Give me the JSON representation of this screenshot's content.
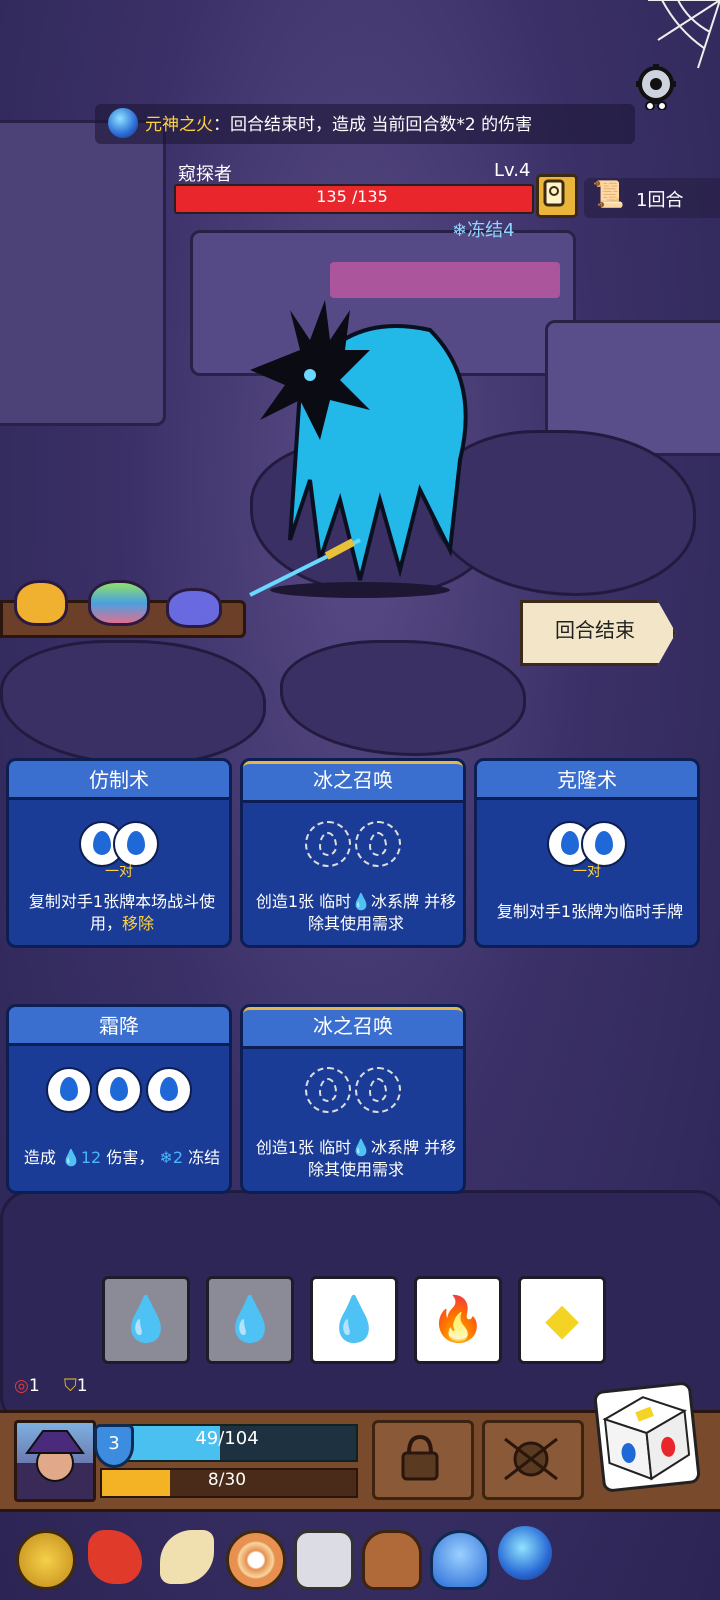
{
  "status_effect": {
    "name": "元神之火",
    "description": "：回合结束时，造成 当前回合数*2 的伤害",
    "icon": "blue-spirit-flame-icon"
  },
  "settings": {
    "icon": "gear-icon"
  },
  "enemy": {
    "name": "窥探者",
    "level": "Lv.4",
    "hp_text": "135 /135",
    "hp_fraction": 1.0,
    "freeze": "冻结4",
    "info_icon": "info-scroll-icon"
  },
  "turn": {
    "label": "1回合",
    "icon": "scroll-icon"
  },
  "end_turn_label": "回合结束",
  "potions": [
    {
      "name": "amber-potion-icon",
      "color": "#f0b030"
    },
    {
      "name": "rainbow-potion-icon",
      "color": "#8fe06a"
    },
    {
      "name": "blue-potion-icon",
      "color": "#6a6ae0"
    }
  ],
  "cards": [
    {
      "title": "仿制术",
      "pair": "一对",
      "desc_main": "复制对手1张牌本场战斗使用，",
      "desc_hl": "移除"
    },
    {
      "title": "冰之召唤",
      "desc_a": "创造1张 临时",
      "desc_b": "冰系牌 并移除其使用需求"
    },
    {
      "title": "克隆术",
      "pair": "一对",
      "desc_main": "复制对手1张牌为临时手牌"
    },
    {
      "title": "霜降",
      "desc_a": "造成",
      "desc_dmg": "12",
      "desc_b": "伤害，",
      "desc_freeze": "2",
      "desc_c": "冻结"
    },
    {
      "title": "冰之召唤",
      "desc_a": "创造1张 临时",
      "desc_b": "冰系牌 并移除其使用需求"
    }
  ],
  "dice": [
    {
      "type": "water",
      "used": true
    },
    {
      "type": "water",
      "used": true
    },
    {
      "type": "water",
      "used": false
    },
    {
      "type": "fire",
      "used": false
    },
    {
      "type": "gold",
      "used": false
    }
  ],
  "player": {
    "shield": "3",
    "hp_text": "49/104",
    "hp_fraction": 0.47,
    "xp_text": "8/30",
    "xp_fraction": 0.27,
    "attack_counter": "1",
    "defense_counter": "1"
  },
  "relics": [
    "gold-coin-icon",
    "red-dragon-icon",
    "horn-icon",
    "ring-target-icon",
    "stone-tablet-icon",
    "leather-bag-icon",
    "blue-mushroom-icon",
    "blue-spirit-icon"
  ],
  "colors": {
    "hp_red": "#e8262c",
    "card_blue": "#1b3c96",
    "accent_gold": "#ffd23f",
    "water": "#1f68d8",
    "fire": "#e8262c"
  }
}
